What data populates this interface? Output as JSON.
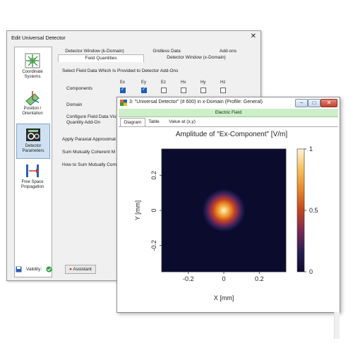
{
  "dialog": {
    "title": "Edit Universal Detector",
    "close_glyph": "✕",
    "sidebar": [
      {
        "label": "Coordinate Systems",
        "icon": "coordinate-systems-icon"
      },
      {
        "label": "Position / Orientation",
        "icon": "position-orientation-icon"
      },
      {
        "label": "Detector Parameters",
        "icon": "detector-parameters-icon",
        "selected": true
      },
      {
        "label": "Free Space Propagation",
        "icon": "free-space-propagation-icon"
      }
    ],
    "tabs_row1": [
      "Detector Window (k-Domain)",
      "Gridless Data",
      "Add-ons"
    ],
    "tabs_row2": [
      "Field Quantities",
      "Detector Window (x-Domain)"
    ],
    "group_title": "Select Field Data Which Is Provided to Detector Add-Ons",
    "columns": [
      "Ex",
      "Ey",
      "Ez",
      "Hx",
      "Hy",
      "Hz"
    ],
    "rows": {
      "components": "Components",
      "domain": "Domain",
      "configure": "Configure Field Data Visu",
      "configure2": "Quantity Add-On",
      "paraxial": "Apply Paraxial Approximat",
      "sum_coherent": "Sum Mutually Coherent M",
      "sum_how": "How to Sum Mutually Com"
    },
    "validity_label": "Validity:",
    "assistant_label": "Assistant"
  },
  "window": {
    "title": "3: \"Universal Detector\" (# 600) in x-Domain (Profile: General)",
    "min_glyph": "−",
    "max_glyph": "□",
    "close_glyph": "✕",
    "field_bar": "Electric Field",
    "tabs": [
      "Diagram",
      "Table",
      "Value at (x,y)"
    ],
    "plot_title": "Amplitude of \"Ex-Component\"  [V/m]"
  },
  "colors": {
    "colormap": [
      "#0b0b2e",
      "#2a1f55",
      "#7a2a55",
      "#c2451f",
      "#e8862a",
      "#f5c15a",
      "#fff4d8"
    ],
    "field_bar": "#ccefc9",
    "sidebar_selected": "#cfe0f2"
  },
  "chart_data": {
    "type": "heatmap",
    "title": "Amplitude of \"Ex-Component\"  [V/m]",
    "xlabel": "X [mm]",
    "ylabel": "Y [mm]",
    "xlim": [
      -0.35,
      0.35
    ],
    "ylim": [
      -0.35,
      0.35
    ],
    "xticks": [
      -0.2,
      0,
      0.2
    ],
    "yticks": [
      0.2,
      0,
      -0.2
    ],
    "xtick_labels": [
      "-0.2",
      "0",
      "0.2"
    ],
    "ytick_labels": [
      "0.2",
      "0",
      "-0.2"
    ],
    "colorbar_range": [
      0,
      1
    ],
    "colorbar_ticks": [
      1,
      0.5,
      0
    ],
    "colorbar_tick_labels": [
      "1",
      "0.5",
      "0"
    ],
    "beam": {
      "center_x": 0,
      "center_y": 0,
      "waist_mm": 0.055,
      "peak": 1
    },
    "grid": false
  }
}
